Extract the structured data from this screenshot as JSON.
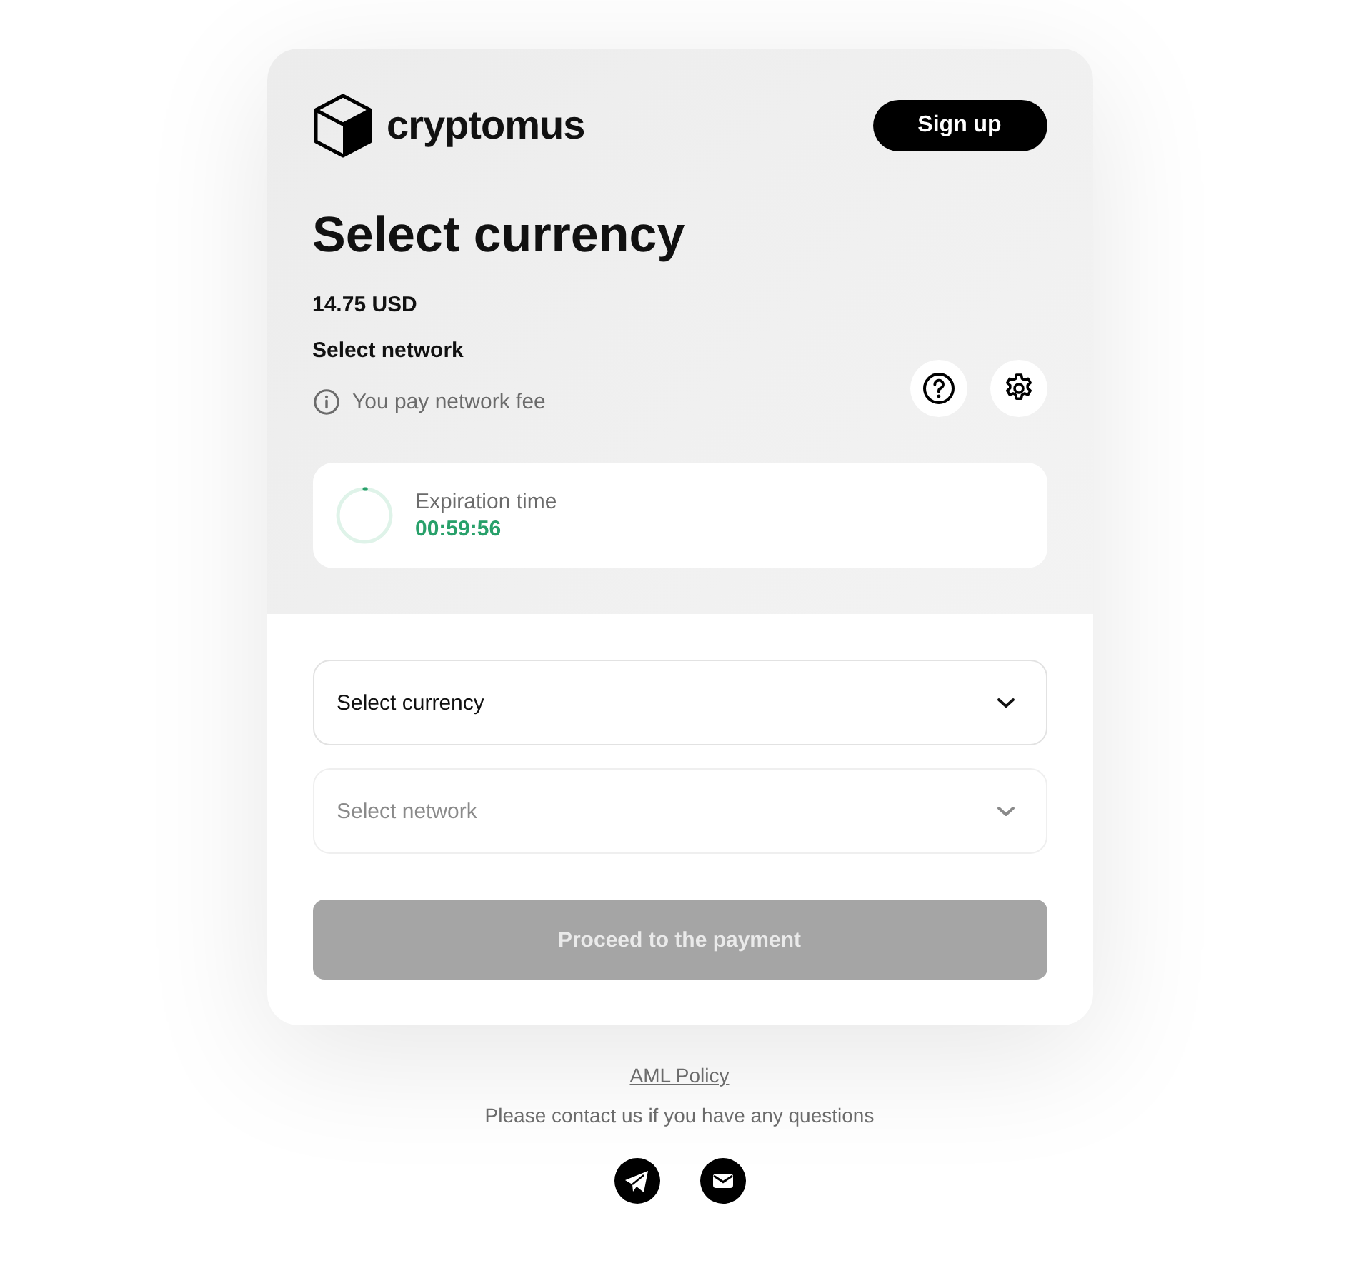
{
  "header": {
    "brand": "cryptomus",
    "signup_button": "Sign up"
  },
  "title": "Select currency",
  "amount": "14.75 USD",
  "network_label": "Select network",
  "fee_note": "You pay network fee",
  "timer": {
    "label": "Expiration time",
    "value": "00:59:56",
    "level": 0.01
  },
  "selects": [
    {
      "placeholder": "Select currency",
      "disabled": false
    },
    {
      "placeholder": "Select network",
      "disabled": true
    }
  ],
  "proceed_button": {
    "label": "Proceed to the payment",
    "disabled": true
  },
  "footer": {
    "link": "AML Policy",
    "contact": "Please contact us if you have any questions"
  }
}
